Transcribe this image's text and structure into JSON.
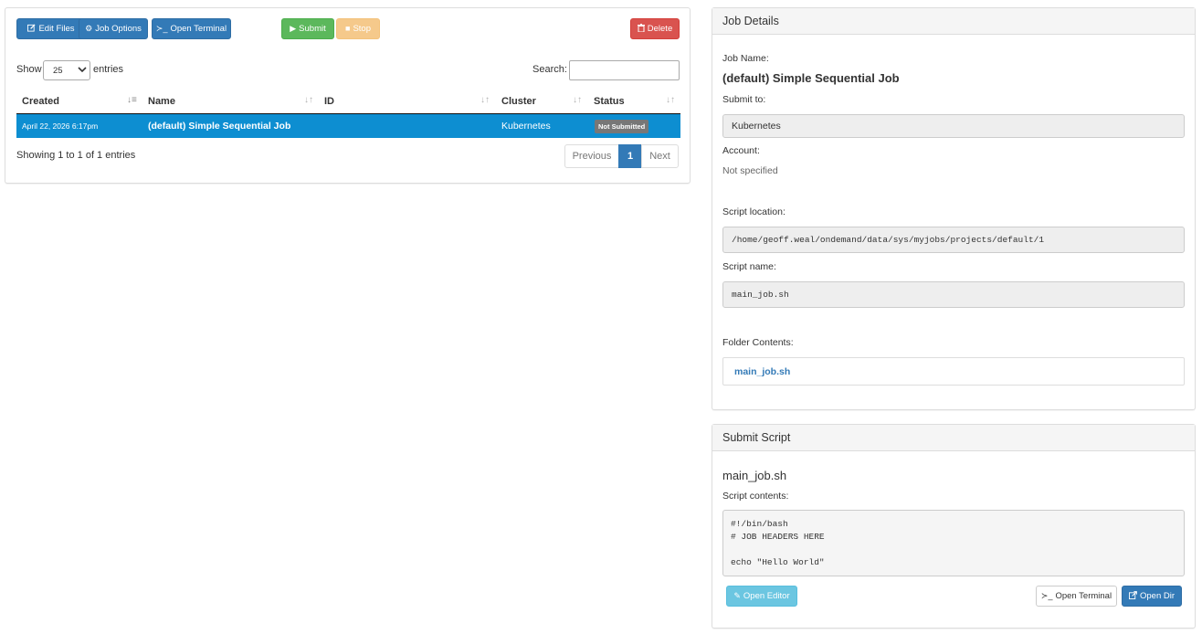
{
  "toolbar": {
    "edit_files": "Edit Files",
    "job_options": "Job Options",
    "open_terminal": "Open Terminal",
    "submit": "Submit",
    "stop": "Stop",
    "delete": "Delete"
  },
  "table_controls": {
    "show_label": "Show",
    "entries_value": "25",
    "entries_label": "entries",
    "search_label": "Search:",
    "search_value": ""
  },
  "table": {
    "columns": [
      "Created",
      "Name",
      "ID",
      "Cluster",
      "Status"
    ],
    "rows": [
      {
        "created": "April 22, 2026 6:17pm",
        "name": "(default) Simple Sequential Job",
        "id": "",
        "cluster": "Kubernetes",
        "status": "Not Submitted"
      }
    ],
    "info": "Showing 1 to 1 of 1 entries",
    "pagination": {
      "previous": "Previous",
      "current": "1",
      "next": "Next"
    }
  },
  "job_details": {
    "heading": "Job Details",
    "job_name_label": "Job Name:",
    "job_name": "(default) Simple Sequential Job",
    "submit_to_label": "Submit to:",
    "submit_to": "Kubernetes",
    "account_label": "Account:",
    "account": "Not specified",
    "script_location_label": "Script location:",
    "script_location": "/home/geoff.weal/ondemand/data/sys/myjobs/projects/default/1",
    "script_name_label": "Script name:",
    "script_name": "main_job.sh",
    "folder_contents_label": "Folder Contents:",
    "folder_files": [
      "main_job.sh"
    ]
  },
  "submit_script": {
    "heading": "Submit Script",
    "file_name": "main_job.sh",
    "contents_label": "Script contents:",
    "contents": "#!/bin/bash\n# JOB HEADERS HERE\n\necho \"Hello World\"",
    "open_editor": "Open Editor",
    "open_terminal": "Open Terminal",
    "open_dir": "Open Dir"
  },
  "colors": {
    "primary": "#337ab7",
    "success": "#5cb85c",
    "warning": "#f0ad4e",
    "danger": "#d9534f",
    "info": "#5bc0de",
    "selected_row": "#0d8ed1",
    "status_badge": "#777777"
  },
  "icons": {
    "edit_files": "pencil-square-icon",
    "job_options": "gear-icon",
    "open_terminal": "terminal-icon",
    "submit": "play-icon",
    "stop": "stop-icon",
    "delete": "trash-icon",
    "open_editor": "pencil-icon",
    "open_dir": "external-link-icon"
  }
}
